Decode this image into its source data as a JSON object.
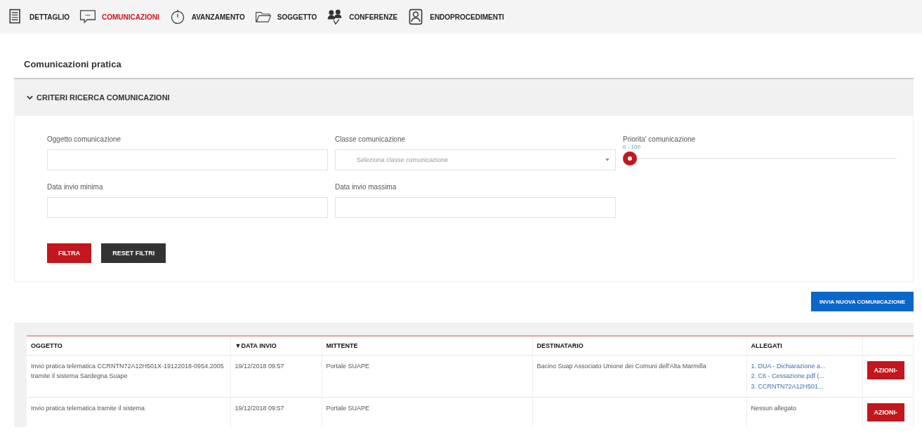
{
  "tabs": [
    {
      "label": "DETTAGLIO",
      "kind": "document",
      "selected": false
    },
    {
      "label": "COMUNICAZIONI",
      "kind": "chat",
      "selected": true
    },
    {
      "label": "AVANZAMENTO",
      "kind": "stopwatch",
      "selected": false
    },
    {
      "label": "SOGGETTO",
      "kind": "folder",
      "selected": false
    },
    {
      "label": "CONFERENZE",
      "kind": "people",
      "selected": false
    },
    {
      "label": "ENDOPROCEDIMENTI",
      "kind": "person",
      "selected": false
    }
  ],
  "section_title": "Comunicazioni pratica",
  "criteria": {
    "title": "CRITERI RICERCA COMUNICAZIONI",
    "expanded": true,
    "fields": [
      {
        "kind": "text",
        "label": "Oggetto comunicazione"
      },
      {
        "kind": "select",
        "label": "Classe comunicazione",
        "placeholder": "Seleziona classe comunicazione"
      },
      {
        "kind": "slider",
        "label": "Priorita' comunicazione",
        "reading": "0 - 100",
        "level": 0
      },
      {
        "kind": "text",
        "label": "Data invio minima"
      },
      {
        "kind": "text",
        "label": "Data invio massima"
      }
    ],
    "buttons": [
      {
        "label": "FILTRA",
        "kind": "primary"
      },
      {
        "label": "RESET FILTRI",
        "kind": "dark"
      }
    ]
  },
  "new_button": "INVIA NUOVA COMUNICAZIONE",
  "table": {
    "columns": [
      {
        "label": "OGGETTO",
        "sorted": false
      },
      {
        "label": "DATA INVIO",
        "sorted": true
      },
      {
        "label": "MITTENTE",
        "sorted": false
      },
      {
        "label": "DESTINATARIO",
        "sorted": false
      },
      {
        "label": "ALLEGATI",
        "sorted": false
      }
    ],
    "sort_arrow": "▼",
    "rows": [
      {
        "oggetto": "Invio pratica telematica CCRNTN72A12H501X-19122018-0954.2005 tramite il sistema Sardegna Suape",
        "data_invio": "19/12/2018 09:57",
        "mittente": "Portale SUAPE",
        "destinatario": "Bacino Suap Associato Unione dei Comuni dell'Alta Marmilla",
        "allegati": [
          "1. DUA - Dichiarazione a...",
          "2. C6 - Cessazione.pdf (...",
          "3. CCRNTN72A12H501..."
        ],
        "azioni": "AZIONI-"
      },
      {
        "oggetto": "Invio pratica telematica tramite il sistema",
        "data_invio": "19/12/2018 09:57",
        "mittente": "Portale SUAPE",
        "no_attachments": "Nessun allegato",
        "allegati": [],
        "azioni": "AZIONI-"
      }
    ]
  }
}
